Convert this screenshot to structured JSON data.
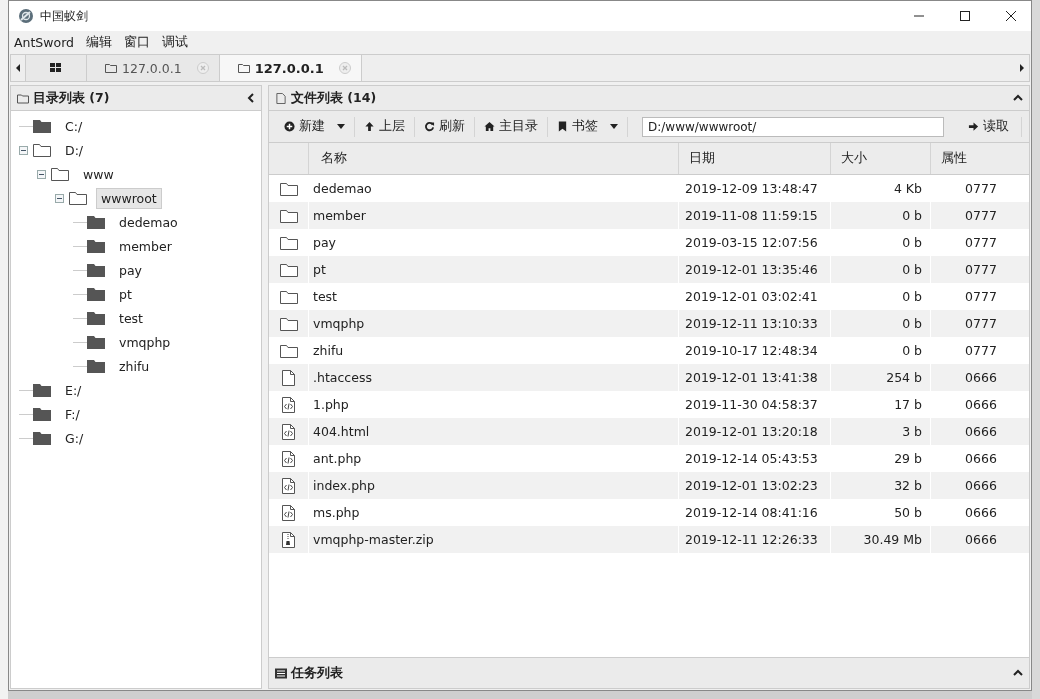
{
  "window": {
    "title": "中国蚁剑"
  },
  "menu": [
    "AntSword",
    "编辑",
    "窗口",
    "调试"
  ],
  "tabs": [
    {
      "kind": "home",
      "selected": false
    },
    {
      "kind": "host",
      "label": "127.0.0.1",
      "selected": false
    },
    {
      "kind": "host",
      "label": "127.0.0.1",
      "selected": true
    }
  ],
  "directory_panel": {
    "title": "目录列表 (7)",
    "tree": [
      {
        "label": "C:/",
        "expanded": false,
        "selected": false
      },
      {
        "label": "D:/",
        "expanded": true,
        "selected": false,
        "children": [
          {
            "label": "www",
            "expanded": true,
            "selected": false,
            "children": [
              {
                "label": "wwwroot",
                "expanded": true,
                "selected": true,
                "children": [
                  {
                    "label": "dedemao",
                    "expanded": false,
                    "selected": false
                  },
                  {
                    "label": "member",
                    "expanded": false,
                    "selected": false
                  },
                  {
                    "label": "pay",
                    "expanded": false,
                    "selected": false
                  },
                  {
                    "label": "pt",
                    "expanded": false,
                    "selected": false
                  },
                  {
                    "label": "test",
                    "expanded": false,
                    "selected": false
                  },
                  {
                    "label": "vmqphp",
                    "expanded": false,
                    "selected": false
                  },
                  {
                    "label": "zhifu",
                    "expanded": false,
                    "selected": false
                  }
                ]
              }
            ]
          }
        ]
      },
      {
        "label": "E:/",
        "expanded": false,
        "selected": false
      },
      {
        "label": "F:/",
        "expanded": false,
        "selected": false
      },
      {
        "label": "G:/",
        "expanded": false,
        "selected": false
      }
    ]
  },
  "file_panel": {
    "title": "文件列表 (14)",
    "toolbar": [
      {
        "kind": "new",
        "label": "新建",
        "dropdown": true
      },
      {
        "kind": "up",
        "label": "上层",
        "dropdown": false
      },
      {
        "kind": "refresh",
        "label": "刷新",
        "dropdown": false
      },
      {
        "kind": "home",
        "label": "主目录",
        "dropdown": false
      },
      {
        "kind": "bookmark",
        "label": "书签",
        "dropdown": true
      }
    ],
    "path": "D:/www/wwwroot/",
    "read_button": "读取",
    "columns": [
      "名称",
      "日期",
      "大小",
      "属性"
    ],
    "rows": [
      {
        "kind": "folder",
        "name": "dedemao",
        "date": "2019-12-09 13:48:47",
        "size": "4 Kb",
        "mode": "0777"
      },
      {
        "kind": "folder",
        "name": "member",
        "date": "2019-11-08 11:59:15",
        "size": "0 b",
        "mode": "0777"
      },
      {
        "kind": "folder",
        "name": "pay",
        "date": "2019-03-15 12:07:56",
        "size": "0 b",
        "mode": "0777"
      },
      {
        "kind": "folder",
        "name": "pt",
        "date": "2019-12-01 13:35:46",
        "size": "0 b",
        "mode": "0777"
      },
      {
        "kind": "folder",
        "name": "test",
        "date": "2019-12-01 03:02:41",
        "size": "0 b",
        "mode": "0777"
      },
      {
        "kind": "folder",
        "name": "vmqphp",
        "date": "2019-12-11 13:10:33",
        "size": "0 b",
        "mode": "0777"
      },
      {
        "kind": "folder",
        "name": "zhifu",
        "date": "2019-10-17 12:48:34",
        "size": "0 b",
        "mode": "0777"
      },
      {
        "kind": "file",
        "name": ".htaccess",
        "date": "2019-12-01 13:41:38",
        "size": "254 b",
        "mode": "0666"
      },
      {
        "kind": "code",
        "name": "1.php",
        "date": "2019-11-30 04:58:37",
        "size": "17 b",
        "mode": "0666"
      },
      {
        "kind": "code",
        "name": "404.html",
        "date": "2019-12-01 13:20:18",
        "size": "3 b",
        "mode": "0666"
      },
      {
        "kind": "code",
        "name": "ant.php",
        "date": "2019-12-14 05:43:53",
        "size": "29 b",
        "mode": "0666"
      },
      {
        "kind": "code",
        "name": "index.php",
        "date": "2019-12-01 13:02:23",
        "size": "32 b",
        "mode": "0666"
      },
      {
        "kind": "code",
        "name": "ms.php",
        "date": "2019-12-14 08:41:16",
        "size": "50 b",
        "mode": "0666"
      },
      {
        "kind": "archive",
        "name": "vmqphp-master.zip",
        "date": "2019-12-11 12:26:33",
        "size": "30.49 Mb",
        "mode": "0666"
      }
    ]
  },
  "task_panel": {
    "title": "任务列表"
  }
}
